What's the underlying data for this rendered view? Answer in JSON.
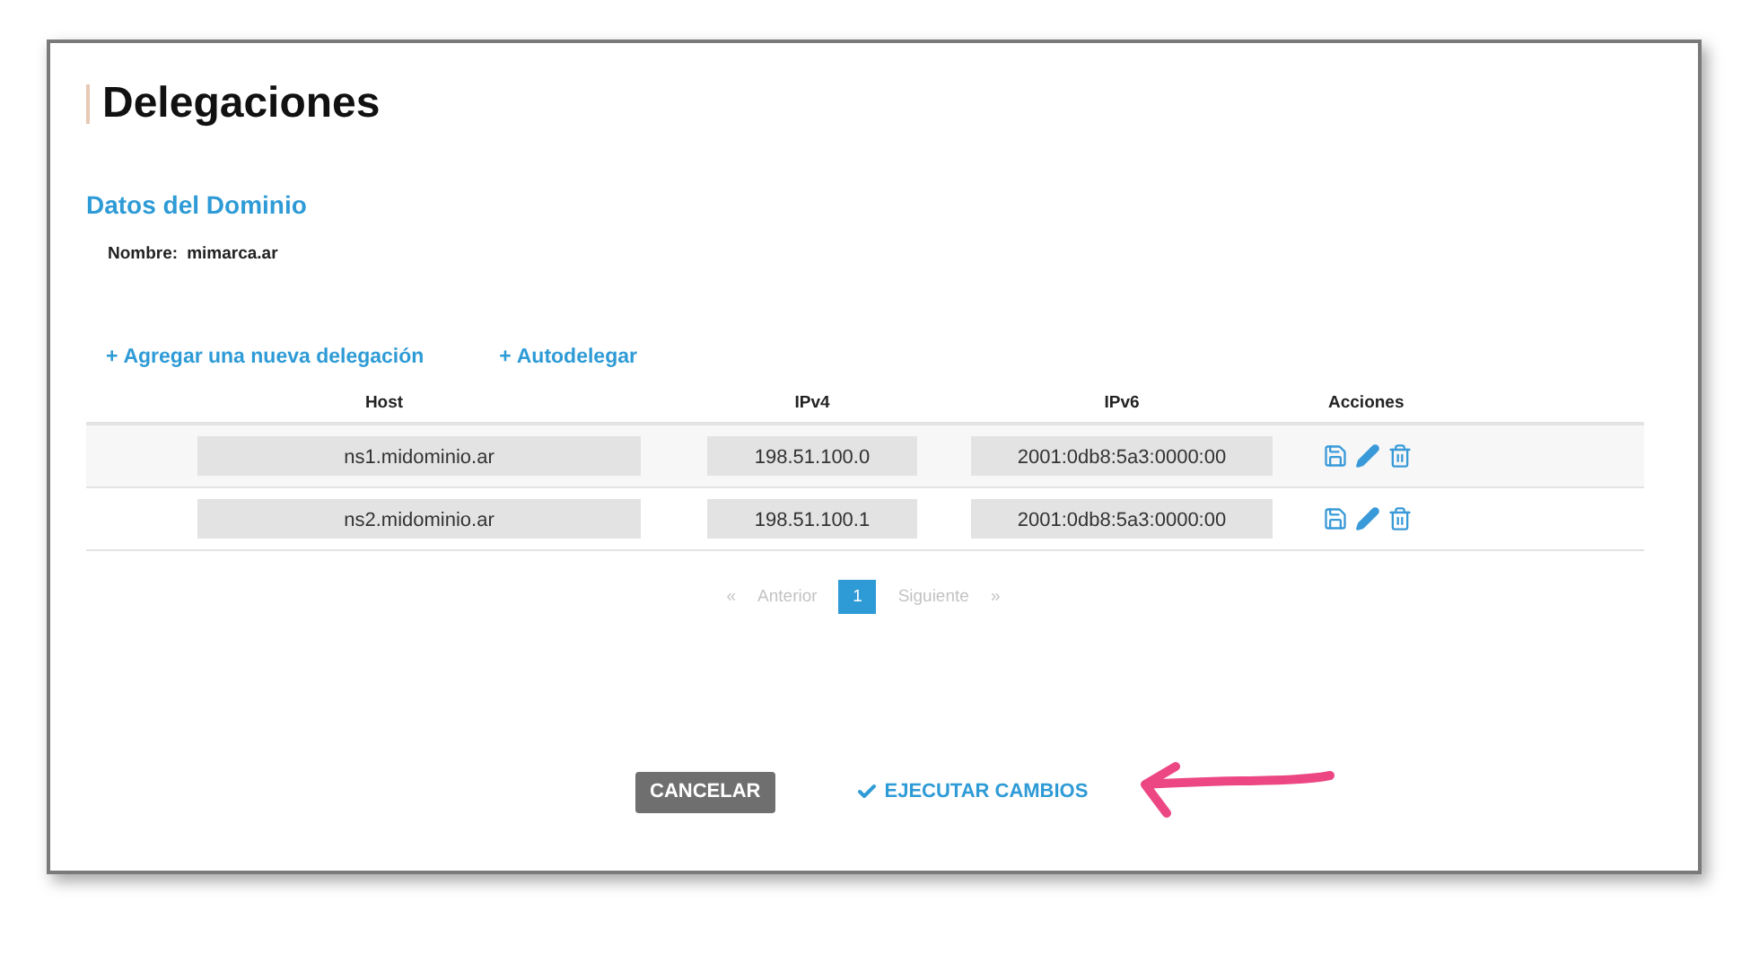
{
  "page": {
    "title": "Delegaciones"
  },
  "domain_section": {
    "heading": "Datos del Dominio",
    "name_label": "Nombre:",
    "name_value": "mimarca.ar"
  },
  "actions": [
    {
      "icon": "+",
      "label": "Agregar una nueva delegación"
    },
    {
      "icon": "+",
      "label": "Autodelegar"
    }
  ],
  "table": {
    "columns": [
      "Host",
      "IPv4",
      "IPv6",
      "Acciones"
    ],
    "rows": [
      {
        "host": "ns1.midominio.ar",
        "ipv4": "198.51.100.0",
        "ipv6": "2001:0db8:5a3:0000:00"
      },
      {
        "host": "ns2.midominio.ar",
        "ipv4": "198.51.100.1",
        "ipv6": "2001:0db8:5a3:0000:00"
      }
    ]
  },
  "pagination": {
    "previous": {
      "arrow": "«",
      "label": "Anterior",
      "disabled": true
    },
    "pages": [
      {
        "label": "1",
        "selected": true
      }
    ],
    "next": {
      "label": "Siguiente",
      "arrow": "»",
      "disabled": true
    }
  },
  "buttons": [
    {
      "kind": "secondary",
      "label": "CANCELAR"
    },
    {
      "kind": "primary",
      "label": "EJECUTAR CAMBIOS"
    }
  ]
}
